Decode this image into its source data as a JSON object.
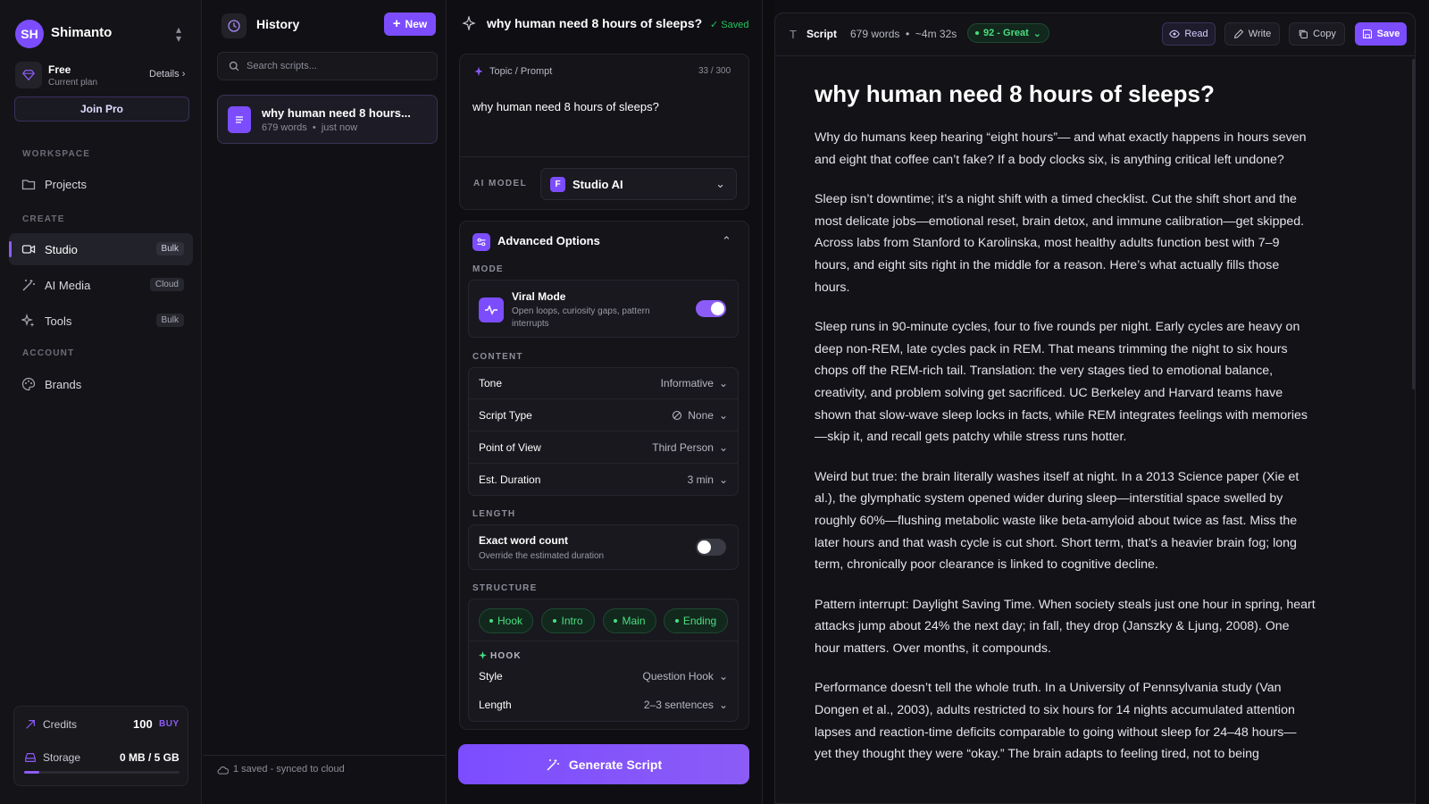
{
  "colors": {
    "accent": "#7c4dff",
    "success": "#22c55e",
    "background": "#0d0d10"
  },
  "user": {
    "initials": "SH",
    "name": "Shimanto"
  },
  "plan": {
    "name": "Free",
    "subtitle": "Current plan",
    "details_label": "Details",
    "join_label": "Join Pro"
  },
  "sidebar": {
    "sections": {
      "workspace": "WORKSPACE",
      "create": "CREATE",
      "account": "ACCOUNT"
    },
    "items": [
      {
        "label": "Projects",
        "icon": "folder-icon"
      },
      {
        "label": "Studio",
        "badge": "Bulk",
        "icon": "video-icon",
        "active": true
      },
      {
        "label": "AI Media",
        "badge": "Cloud",
        "icon": "magic-wand-icon"
      },
      {
        "label": "Tools",
        "badge": "Bulk",
        "icon": "sparkles-icon"
      },
      {
        "label": "Brands",
        "icon": "palette-icon"
      }
    ],
    "credits": {
      "label": "Credits",
      "value": "100",
      "buy_label": "BUY"
    },
    "storage": {
      "label": "Storage",
      "value": "0 MB / 5 GB",
      "used_fraction": 0.1
    }
  },
  "history": {
    "title": "History",
    "new_label": "New",
    "search_placeholder": "Search scripts...",
    "items": [
      {
        "title": "why human need 8 hours...",
        "words": "679 words",
        "time": "just now"
      }
    ],
    "footer": "1 saved - synced to cloud"
  },
  "config": {
    "title": "why human need 8 hours of sleeps?",
    "saved_label": "Saved",
    "topic": {
      "label": "Topic / Prompt",
      "count": "33 / 300",
      "text": "why human need 8 hours of sleeps?"
    },
    "model": {
      "label": "AI MODEL",
      "value": "Studio AI",
      "badge": "F"
    },
    "advanced": {
      "title": "Advanced Options",
      "mode_label": "MODE",
      "viral": {
        "title": "Viral Mode",
        "desc": "Open loops, curiosity gaps, pattern interrupts",
        "enabled": true
      },
      "content_label": "CONTENT",
      "content": [
        {
          "label": "Tone",
          "value": "Informative"
        },
        {
          "label": "Script Type",
          "value": "None"
        },
        {
          "label": "Point of View",
          "value": "Third Person"
        },
        {
          "label": "Est. Duration",
          "value": "3 min"
        }
      ],
      "length_label": "LENGTH",
      "exact": {
        "title": "Exact word count",
        "desc": "Override the estimated duration",
        "enabled": false
      },
      "structure_label": "STRUCTURE",
      "structure": [
        "Hook",
        "Intro",
        "Main",
        "Ending"
      ],
      "hook_label": "HOOK",
      "hook": [
        {
          "label": "Style",
          "value": "Question Hook"
        },
        {
          "label": "Length",
          "value": "2–3 sentences"
        }
      ]
    },
    "generate_label": "Generate Script"
  },
  "script": {
    "label": "Script",
    "words": "679 words",
    "duration": "~4m 32s",
    "score": "92 - Great",
    "buttons": {
      "read": "Read",
      "write": "Write",
      "copy": "Copy",
      "save": "Save"
    },
    "title": "why human need 8 hours of sleeps?",
    "paragraphs": [
      "Why do humans keep hearing “eight hours”— and what exactly happens in hours seven and eight that coffee can’t fake? If a body clocks six, is anything critical left undone?",
      "Sleep isn’t downtime; it’s a night shift with a timed checklist. Cut the shift short and the most delicate jobs—emotional reset, brain detox, and immune calibration—get skipped. Across labs from Stanford to Karolinska, most healthy adults function best with 7–9 hours, and eight sits right in the middle for a reason. Here’s what actually fills those hours.",
      "Sleep runs in 90-minute cycles, four to five rounds per night. Early cycles are heavy on deep non-REM, late cycles pack in REM. That means trimming the night to six hours chops off the REM-rich tail. Translation: the very stages tied to emotional balance, creativity, and problem solving get sacrificed. UC Berkeley and Harvard teams have shown that slow-wave sleep locks in facts, while REM integrates feelings with memories —skip it, and recall gets patchy while stress runs hotter.",
      "Weird but true: the brain literally washes itself at night. In a 2013 Science paper (Xie et al.), the glymphatic system opened wider during sleep—interstitial space swelled by roughly 60%—flushing metabolic waste like beta-amyloid about twice as fast. Miss the later hours and that wash cycle is cut short. Short term, that’s a heavier brain fog; long term, chronically poor clearance is linked to cognitive decline.",
      "Pattern interrupt: Daylight Saving Time. When society steals just one hour in spring, heart attacks jump about 24% the next day; in fall, they drop (Janszky & Ljung, 2008). One hour matters. Over months, it compounds.",
      "Performance doesn’t tell the whole truth. In a University of Pennsylvania study (Van Dongen et al., 2003), adults restricted to six hours for 14 nights accumulated attention lapses and reaction-time deficits comparable to going without sleep for 24–48 hours— yet they thought they were “okay.” The brain adapts to feeling tired, not to being"
    ]
  }
}
